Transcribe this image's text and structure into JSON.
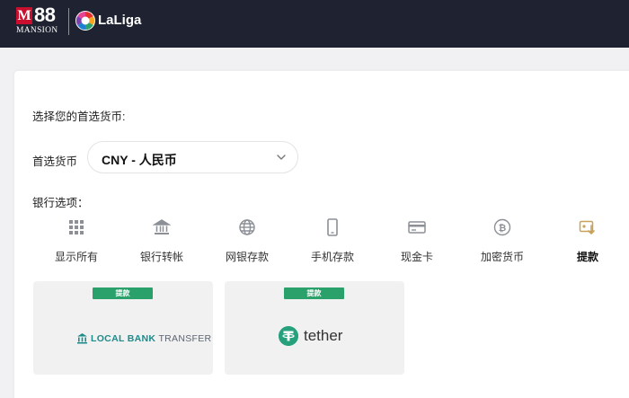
{
  "header": {
    "brand_m88_box": "M",
    "brand_m88_num": "88",
    "brand_m88_sub": "MANSION",
    "partner_name": "LaLiga",
    "bg_color": "#1f2230"
  },
  "currency": {
    "title": "选择您的首选货币:",
    "label": "首选货币",
    "selected": "CNY - 人民币"
  },
  "bank": {
    "label": "银行选项：",
    "options": [
      {
        "label": "显示所有",
        "icon": "grid-icon"
      },
      {
        "label": "银行转帐",
        "icon": "bank-icon"
      },
      {
        "label": "网银存款",
        "icon": "globe-icon"
      },
      {
        "label": "手机存款",
        "icon": "mobile-icon"
      },
      {
        "label": "现金卡",
        "icon": "card-icon"
      },
      {
        "label": "加密货币",
        "icon": "bitcoin-icon"
      },
      {
        "label": "提款",
        "icon": "withdraw-icon"
      }
    ],
    "active_index": 6
  },
  "methods": [
    {
      "badge": "提款",
      "name_a": "LOCAL BANK",
      "name_b": "TRANSFER"
    },
    {
      "badge": "提款",
      "name": "tether"
    }
  ],
  "colors": {
    "badge_green": "#2aa16a",
    "tether_green": "#26a17b",
    "active_icon": "#c9a25a"
  }
}
